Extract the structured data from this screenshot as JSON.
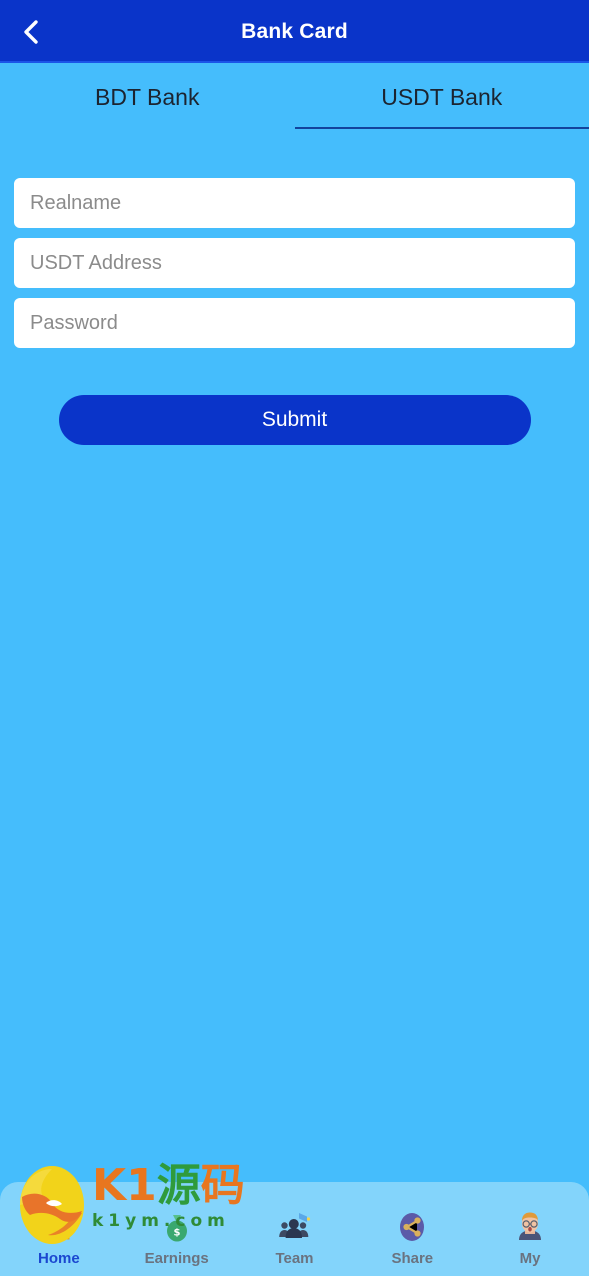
{
  "header": {
    "title": "Bank Card",
    "back_icon": "chevron-left-icon",
    "bg_color": "#0a34c9",
    "title_color": "#ffffff"
  },
  "theme": {
    "page_bg": "#45bdfc",
    "accent": "#0a34c9",
    "nav_bg": "#83d4fb",
    "active_nav_color": "#1b47d0",
    "inactive_nav_color": "#6a7380",
    "tab_underline": "#13439c",
    "placeholder_color": "#8b8b8b"
  },
  "tabs": [
    {
      "label": "BDT Bank",
      "active": false
    },
    {
      "label": "USDT Bank",
      "active": true
    }
  ],
  "form": {
    "fields": [
      {
        "name": "realname",
        "placeholder": "Realname",
        "value": "",
        "type": "text"
      },
      {
        "name": "usdt-address",
        "placeholder": "USDT Address",
        "value": "",
        "type": "text"
      },
      {
        "name": "password",
        "placeholder": "Password",
        "value": "",
        "type": "password"
      }
    ],
    "submit_label": "Submit"
  },
  "bottom_nav": [
    {
      "label": "Home",
      "icon": "home-icon",
      "active": true
    },
    {
      "label": "Earnings",
      "icon": "earnings-money-bag-icon",
      "active": false
    },
    {
      "label": "Team",
      "icon": "team-people-icon",
      "active": false
    },
    {
      "label": "Share",
      "icon": "share-network-icon",
      "active": false
    },
    {
      "label": "My",
      "icon": "avatar-person-icon",
      "active": false
    }
  ],
  "watermark": {
    "main_text_orange_1": "K1",
    "main_text_green": "源",
    "main_text_orange_2": "码",
    "sub_text": "k1ym.com"
  }
}
